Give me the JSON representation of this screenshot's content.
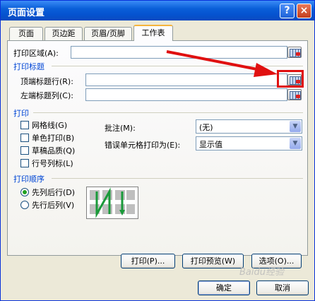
{
  "window": {
    "title": "页面设置",
    "help_glyph": "?",
    "close_glyph": "×"
  },
  "tabs": [
    {
      "label": "页面"
    },
    {
      "label": "页边距"
    },
    {
      "label": "页眉/页脚"
    },
    {
      "label": "工作表",
      "active": true
    }
  ],
  "print_area": {
    "label": "打印区域(A):",
    "value": ""
  },
  "print_titles": {
    "section": "打印标题",
    "rows_label": "顶端标题行(R):",
    "rows_value": "",
    "cols_label": "左端标题列(C):",
    "cols_value": ""
  },
  "print": {
    "section": "打印",
    "checkboxes": [
      {
        "label": "网格线(G)",
        "checked": false
      },
      {
        "label": "单色打印(B)",
        "checked": false
      },
      {
        "label": "草稿品质(Q)",
        "checked": false
      },
      {
        "label": "行号列标(L)",
        "checked": false
      }
    ],
    "comments_label": "批注(M):",
    "comments_value": "(无)",
    "errors_label": "错误单元格打印为(E):",
    "errors_value": "显示值"
  },
  "page_order": {
    "section": "打印顺序",
    "options": [
      {
        "label": "先列后行(D)",
        "selected": true
      },
      {
        "label": "先行后列(V)",
        "selected": false
      }
    ]
  },
  "buttons": {
    "print": "打印(P)...",
    "preview": "打印预览(W)",
    "options": "选项(O)...",
    "ok": "确定",
    "cancel": "取消"
  },
  "annotation": {
    "color": "#e01010"
  },
  "watermark": "Baidu经验",
  "colors": {
    "titlebar": "#0553d0",
    "section": "#0046d5",
    "annotation": "#e01010"
  }
}
